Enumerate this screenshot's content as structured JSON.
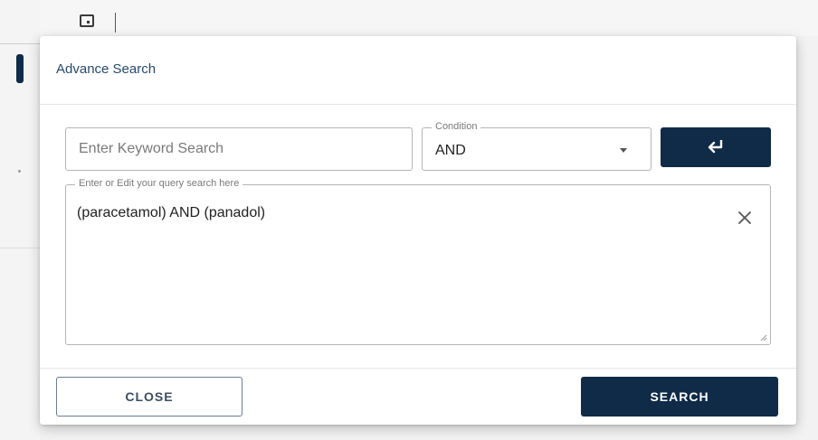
{
  "dialog": {
    "title": "Advance Search",
    "keyword_input": {
      "placeholder": "Enter Keyword Search",
      "value": ""
    },
    "condition": {
      "label": "Condition",
      "selected": "AND"
    },
    "enter_button_icon": "enter-return-icon",
    "query": {
      "label": "Enter or Edit your query search here",
      "value": "(paracetamol) AND (panadol)"
    },
    "clear_icon": "close-x-icon",
    "buttons": {
      "close": "CLOSE",
      "search": "SEARCH"
    }
  },
  "colors": {
    "primary": "#0f2b47",
    "title": "#27496d",
    "border": "#b5b5b5"
  }
}
